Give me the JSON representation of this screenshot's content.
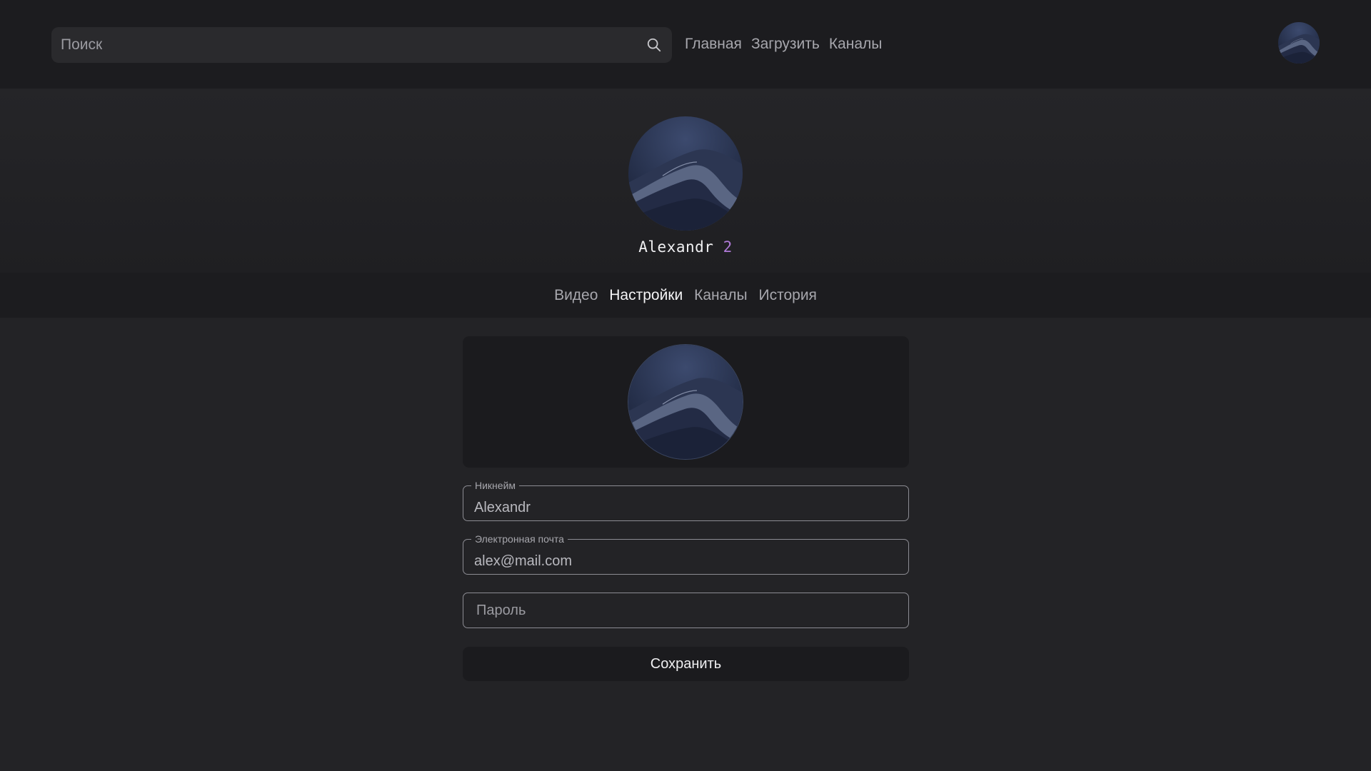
{
  "header": {
    "search": {
      "placeholder": "Поиск",
      "icon": "search-icon"
    },
    "nav": [
      "Главная",
      "Загрузить",
      "Каналы"
    ],
    "avatar": "user-avatar"
  },
  "profile": {
    "name": "Alexandr",
    "number": "2"
  },
  "tabs": {
    "items": [
      "Видео",
      "Настройки",
      "Каналы",
      "История"
    ],
    "active": "Настройки"
  },
  "settings": {
    "nickname": {
      "label": "Никнейм",
      "value": "Alexandr"
    },
    "email": {
      "label": "Электронная почта",
      "value": "alex@mail.com"
    },
    "password": {
      "placeholder": "Пароль"
    },
    "save_label": "Сохранить"
  },
  "colors": {
    "background": "#232326",
    "header": "#1c1c1f",
    "accent_number": "#b07ad8"
  }
}
